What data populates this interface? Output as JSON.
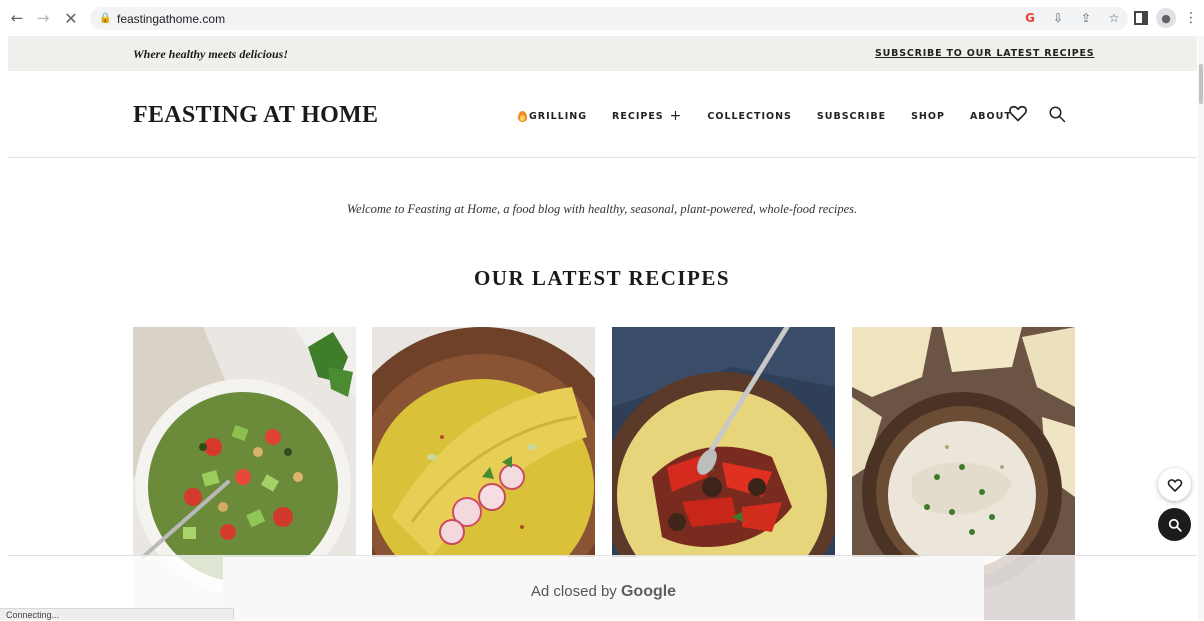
{
  "browser": {
    "url": "feastingathome.com",
    "icons": [
      "back-arrow-icon",
      "forward-arrow-icon",
      "stop-icon",
      "lock-icon",
      "google-icon",
      "install-icon",
      "share-icon",
      "star-icon",
      "side-panel-icon",
      "profile-icon",
      "menu-icon"
    ],
    "status": "Connecting..."
  },
  "topbar": {
    "tagline": "Where healthy meets delicious!",
    "subscribe_link": "SUBSCRIBE TO OUR LATEST RECIPES"
  },
  "header": {
    "logo": "FEASTING AT HOME",
    "nav": [
      {
        "label": "GRILLING",
        "icon": "flame-icon"
      },
      {
        "label": "RECIPES",
        "icon": "plus-icon"
      },
      {
        "label": "COLLECTIONS"
      },
      {
        "label": "SUBSCRIBE"
      },
      {
        "label": "SHOP"
      },
      {
        "label": "ABOUT"
      }
    ],
    "icons": [
      "heart-icon",
      "search-icon"
    ]
  },
  "main": {
    "welcome": "Welcome to Feasting at Home, a food blog with healthy, seasonal, plant-powered, whole-food recipes.",
    "section_title": "OUR LATEST RECIPES",
    "cards": [
      {
        "image": "chopped salad with tomatoes and avocado"
      },
      {
        "image": "omelette with yellow sauce and radishes"
      },
      {
        "image": "roasted peppers and eggplant over polenta"
      },
      {
        "image": "creamy dip with chips"
      }
    ]
  },
  "floating": {
    "icons": [
      "heart-icon",
      "search-icon"
    ]
  },
  "ad": {
    "prefix": "Ad closed by",
    "brand": "Google"
  },
  "colors": {
    "topbar_bg": "#f1efeb",
    "text_dark": "#1a1a1a",
    "flame": "#f08a1c"
  }
}
